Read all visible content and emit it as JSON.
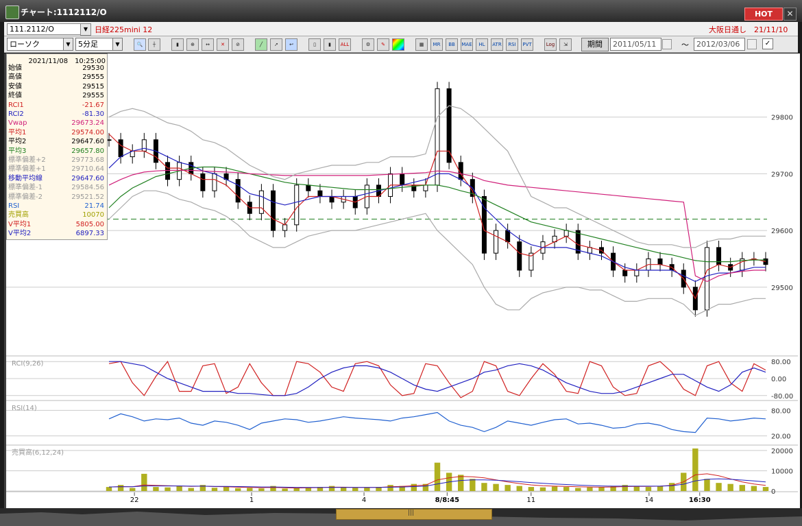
{
  "window": {
    "title": "チャート:1112112/O",
    "hot_label": "HOT",
    "close_glyph": "✕"
  },
  "toolbar1": {
    "symbol_code": "111.2112/O",
    "symbol_name": "日経225mini 12",
    "market_info": "大阪日通し　21/11/10"
  },
  "toolbar2": {
    "chart_type": "ローソク",
    "interval": "5分足",
    "period_label": "期間",
    "date_from": "2011/05/11",
    "date_to": "2012/03/06",
    "tilde": "〜",
    "buttons": [
      "MR",
      "BB",
      "MAE",
      "HL",
      "ATR",
      "RSI",
      "PVT",
      "Log"
    ]
  },
  "info": {
    "timestamp": "2021/11/08　10:25:00",
    "rows": [
      {
        "label": "始値",
        "value": "29530",
        "color": "#000000"
      },
      {
        "label": "高値",
        "value": "29555",
        "color": "#000000"
      },
      {
        "label": "安値",
        "value": "29515",
        "color": "#000000"
      },
      {
        "label": "終値",
        "value": "29555",
        "color": "#000000"
      },
      {
        "label": "RCI1",
        "value": "-21.67",
        "color": "#d02020"
      },
      {
        "label": "RCI2",
        "value": "-81.30",
        "color": "#2020c0"
      },
      {
        "label": "Vwap",
        "value": "29673.24",
        "color": "#d0207a"
      },
      {
        "label": "平均1",
        "value": "29574.00",
        "color": "#d02020"
      },
      {
        "label": "平均2",
        "value": "29647.60",
        "color": "#000000"
      },
      {
        "label": "平均3",
        "value": "29657.80",
        "color": "#208020"
      },
      {
        "label": "標準偏差+2",
        "value": "29773.68",
        "color": "#999999"
      },
      {
        "label": "標準偏差+1",
        "value": "29710.64",
        "color": "#999999"
      },
      {
        "label": "移動平均線",
        "value": "29647.60",
        "color": "#2020c0"
      },
      {
        "label": "標準偏差-1",
        "value": "29584.56",
        "color": "#999999"
      },
      {
        "label": "標準偏差-2",
        "value": "29521.52",
        "color": "#999999"
      },
      {
        "label": "RSI",
        "value": "21.74",
        "color": "#2060d0"
      },
      {
        "label": "売買高",
        "value": "10070",
        "color": "#a0a000"
      },
      {
        "label": "V平均1",
        "value": "5805.00",
        "color": "#d02020"
      },
      {
        "label": "V平均2",
        "value": "6897.33",
        "color": "#2020c0"
      }
    ]
  },
  "chart_data": [
    {
      "type": "line",
      "title": "",
      "ylim": [
        29380,
        29900
      ],
      "y_ticks": [
        29800,
        29700,
        29600,
        29500
      ],
      "x_tick_labels": [
        "22",
        "1",
        "4",
        "8/8:45",
        "11",
        "14",
        "16:30"
      ],
      "x_tick_positions": [
        0.162,
        0.31,
        0.452,
        0.557,
        0.663,
        0.812,
        0.876
      ],
      "reference_line": 29620,
      "series": [
        {
          "name": "close",
          "values": [
            29760,
            29730,
            29740,
            29760,
            29720,
            29690,
            29720,
            29700,
            29670,
            29700,
            29690,
            29650,
            29630,
            29670,
            29600,
            29610,
            29680,
            29670,
            29660,
            29650,
            29660,
            29640,
            29680,
            29660,
            29700,
            29680,
            29670,
            29680,
            29850,
            29720,
            29690,
            29660,
            29560,
            29600,
            29580,
            29530,
            29560,
            29580,
            29590,
            29600,
            29560,
            29570,
            29560,
            29530,
            29520,
            29530,
            29550,
            29540,
            29530,
            29500,
            29460,
            29570,
            29540,
            29530,
            29550,
            29550,
            29540
          ]
        },
        {
          "name": "平均1",
          "values": [
            29770,
            29750,
            29740,
            29740,
            29730,
            29710,
            29710,
            29700,
            29690,
            29690,
            29680,
            29660,
            29640,
            29640,
            29620,
            29610,
            29640,
            29660,
            29660,
            29660,
            29655,
            29650,
            29660,
            29660,
            29680,
            29680,
            29680,
            29680,
            29740,
            29740,
            29700,
            29670,
            29600,
            29590,
            29580,
            29560,
            29555,
            29570,
            29580,
            29590,
            29575,
            29570,
            29565,
            29545,
            29530,
            29530,
            29540,
            29540,
            29535,
            29515,
            29480,
            29530,
            29540,
            29535,
            29545,
            29550,
            29545
          ]
        },
        {
          "name": "移動平均線",
          "values": [
            29710,
            29730,
            29740,
            29745,
            29740,
            29730,
            29720,
            29715,
            29705,
            29700,
            29690,
            29680,
            29665,
            29660,
            29650,
            29645,
            29650,
            29655,
            29660,
            29660,
            29660,
            29660,
            29665,
            29670,
            29675,
            29680,
            29685,
            29690,
            29700,
            29700,
            29690,
            29675,
            29640,
            29620,
            29600,
            29585,
            29575,
            29570,
            29570,
            29570,
            29565,
            29560,
            29555,
            29545,
            29535,
            29530,
            29530,
            29530,
            29530,
            29520,
            29510,
            29520,
            29525,
            29525,
            29530,
            29535,
            29535
          ]
        },
        {
          "name": "平均3",
          "values": [
            29640,
            29660,
            29675,
            29685,
            29695,
            29700,
            29705,
            29710,
            29712,
            29712,
            29710,
            29705,
            29700,
            29695,
            29690,
            29685,
            29682,
            29680,
            29678,
            29676,
            29674,
            29672,
            29672,
            29672,
            29674,
            29676,
            29678,
            29680,
            29680,
            29676,
            29670,
            29665,
            29655,
            29645,
            29635,
            29625,
            29615,
            29610,
            29605,
            29600,
            29595,
            29590,
            29585,
            29580,
            29575,
            29570,
            29565,
            29560,
            29557,
            29552,
            29547,
            29545,
            29545,
            29545,
            29547,
            29548,
            29548
          ]
        },
        {
          "name": "Vwap",
          "values": [
            29680,
            29690,
            29698,
            29703,
            29705,
            29706,
            29706,
            29706,
            29705,
            29704,
            29703,
            29702,
            29700,
            29699,
            29698,
            29697,
            29697,
            29697,
            29697,
            29697,
            29697,
            29697,
            29697,
            29698,
            29699,
            29700,
            29701,
            29702,
            29705,
            29704,
            29700,
            29696,
            29688,
            29684,
            29680,
            29678,
            29676,
            29674,
            29672,
            29670,
            29668,
            29666,
            29664,
            29662,
            29660,
            29658,
            29656,
            29654,
            29652,
            29650,
            29520,
            29510,
            29520,
            29525,
            29528,
            29530,
            29530
          ]
        },
        {
          "name": "標準偏差+2",
          "values": [
            29800,
            29810,
            29815,
            29810,
            29800,
            29790,
            29785,
            29775,
            29760,
            29755,
            29745,
            29730,
            29715,
            29705,
            29695,
            29690,
            29700,
            29705,
            29710,
            29715,
            29715,
            29715,
            29720,
            29720,
            29730,
            29730,
            29730,
            29735,
            29800,
            29820,
            29815,
            29800,
            29780,
            29760,
            29740,
            29700,
            29660,
            29650,
            29640,
            29640,
            29630,
            29620,
            29610,
            29600,
            29590,
            29580,
            29575,
            29575,
            29575,
            29570,
            29570,
            29580,
            29585,
            29585,
            29590,
            29590,
            29590
          ]
        },
        {
          "name": "標準偏差-2",
          "values": [
            29620,
            29640,
            29660,
            29670,
            29670,
            29665,
            29655,
            29650,
            29640,
            29635,
            29625,
            29610,
            29590,
            29580,
            29570,
            29570,
            29580,
            29590,
            29595,
            29600,
            29600,
            29600,
            29605,
            29610,
            29615,
            29620,
            29625,
            29630,
            29600,
            29580,
            29560,
            29540,
            29500,
            29470,
            29460,
            29460,
            29480,
            29490,
            29495,
            29500,
            29500,
            29495,
            29495,
            29485,
            29475,
            29475,
            29480,
            29480,
            29480,
            29470,
            29450,
            29460,
            29470,
            29470,
            29475,
            29480,
            29480
          ]
        }
      ]
    },
    {
      "type": "line",
      "title": "RCI(9,26)",
      "ylim": [
        -100,
        100
      ],
      "y_ticks": [
        80,
        0,
        -80
      ],
      "y_tick_labels": [
        "80.00",
        "0.00",
        "-80.00"
      ],
      "series": [
        {
          "name": "RCI1",
          "values": [
            70,
            80,
            -20,
            -80,
            10,
            80,
            -60,
            -60,
            60,
            70,
            -70,
            -40,
            70,
            -20,
            -80,
            -80,
            80,
            70,
            30,
            -40,
            -60,
            70,
            80,
            60,
            -30,
            -80,
            -70,
            70,
            60,
            -20,
            -90,
            -60,
            80,
            60,
            -60,
            -80,
            0,
            70,
            20,
            -60,
            -70,
            80,
            60,
            -40,
            -80,
            -70,
            60,
            80,
            30,
            -50,
            -80,
            60,
            80,
            -20,
            -60,
            70,
            40
          ]
        },
        {
          "name": "RCI2",
          "values": [
            80,
            80,
            70,
            60,
            30,
            0,
            -20,
            -40,
            -60,
            -60,
            -60,
            -70,
            -70,
            -75,
            -80,
            -80,
            -70,
            -40,
            0,
            30,
            50,
            60,
            60,
            50,
            30,
            0,
            -30,
            -50,
            -60,
            -40,
            -20,
            0,
            30,
            40,
            60,
            70,
            60,
            40,
            10,
            -20,
            -40,
            -60,
            -70,
            -70,
            -60,
            -40,
            -20,
            0,
            20,
            20,
            -10,
            -40,
            -60,
            -30,
            30,
            50,
            30
          ]
        }
      ]
    },
    {
      "type": "line",
      "title": "RSI(14)",
      "ylim": [
        0,
        100
      ],
      "y_ticks": [
        80,
        20
      ],
      "y_tick_labels": [
        "80.00",
        "20.00"
      ],
      "series": [
        {
          "name": "RSI",
          "values": [
            60,
            72,
            65,
            55,
            60,
            58,
            62,
            50,
            45,
            55,
            52,
            45,
            35,
            50,
            55,
            60,
            58,
            52,
            55,
            60,
            65,
            62,
            60,
            58,
            55,
            62,
            65,
            70,
            75,
            55,
            45,
            40,
            30,
            40,
            55,
            50,
            45,
            52,
            58,
            60,
            48,
            50,
            45,
            38,
            40,
            48,
            50,
            45,
            35,
            30,
            28,
            62,
            60,
            55,
            58,
            62,
            60
          ]
        }
      ]
    },
    {
      "type": "bar",
      "title": "売買高(6,12,24)",
      "ylim": [
        0,
        22000
      ],
      "y_ticks": [
        20000,
        10000,
        0
      ],
      "y_tick_labels": [
        "20000",
        "10000",
        "0"
      ],
      "series": [
        {
          "name": "売買高",
          "values": [
            2000,
            3000,
            1500,
            8500,
            2000,
            1800,
            2500,
            1500,
            3000,
            1600,
            2000,
            1400,
            1500,
            1300,
            2500,
            1200,
            1400,
            1800,
            2000,
            2500,
            1700,
            1600,
            1800,
            2000,
            3000,
            2500,
            3500,
            3500,
            14000,
            9000,
            8000,
            6000,
            4000,
            3500,
            3000,
            2500,
            2000,
            1800,
            2200,
            2000,
            1500,
            1800,
            2000,
            2500,
            3000,
            2500,
            2000,
            2500,
            4000,
            9000,
            21000,
            6000,
            4000,
            3500,
            3000,
            2500,
            2000
          ]
        },
        {
          "name": "V平均1",
          "values": [
            2000,
            2200,
            2100,
            3000,
            2800,
            2600,
            2500,
            2300,
            2400,
            2200,
            2100,
            1900,
            1800,
            1700,
            1800,
            1600,
            1500,
            1600,
            1700,
            1900,
            1900,
            1800,
            1800,
            1800,
            2100,
            2300,
            2600,
            2900,
            5500,
            6500,
            7200,
            7000,
            6500,
            5500,
            4500,
            3700,
            3000,
            2600,
            2400,
            2300,
            2100,
            2000,
            1900,
            2000,
            2200,
            2300,
            2300,
            2400,
            2800,
            4500,
            8000,
            8500,
            7500,
            6000,
            4500,
            3500,
            2800
          ]
        },
        {
          "name": "V平均2",
          "values": [
            2000,
            2100,
            2100,
            2500,
            2500,
            2500,
            2500,
            2400,
            2400,
            2300,
            2300,
            2200,
            2100,
            2000,
            2000,
            1900,
            1800,
            1800,
            1800,
            1800,
            1800,
            1800,
            1800,
            1800,
            1900,
            2000,
            2200,
            2400,
            3500,
            4500,
            5200,
            5500,
            5500,
            5300,
            5000,
            4600,
            4200,
            3800,
            3500,
            3200,
            2900,
            2700,
            2500,
            2400,
            2400,
            2400,
            2400,
            2400,
            2600,
            3400,
            5000,
            5800,
            6000,
            5800,
            5400,
            5000,
            4500
          ]
        }
      ]
    }
  ]
}
